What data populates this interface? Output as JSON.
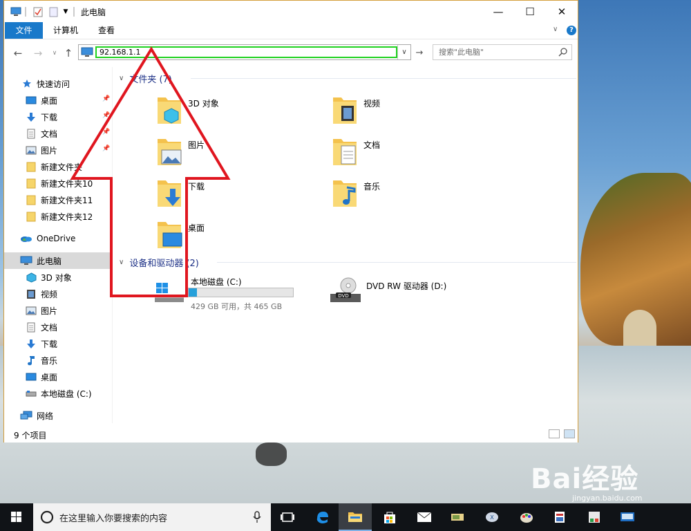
{
  "window": {
    "title": "此电脑",
    "controls": [
      "minimize-icon",
      "maximize-icon",
      "close-icon"
    ]
  },
  "ribbon": {
    "tabs": [
      "文件",
      "计算机",
      "查看"
    ]
  },
  "address": {
    "value": "92.168.1.1",
    "search_placeholder": "搜索\"此电脑\""
  },
  "sidebar": {
    "items": [
      {
        "label": "快速访问",
        "icon": "star-icon",
        "pinned": false
      },
      {
        "label": "桌面",
        "icon": "desktop-icon",
        "pinned": true
      },
      {
        "label": "下载",
        "icon": "download-icon",
        "pinned": true
      },
      {
        "label": "文档",
        "icon": "document-icon",
        "pinned": true
      },
      {
        "label": "图片",
        "icon": "picture-icon",
        "pinned": true
      },
      {
        "label": "新建文件夹",
        "icon": "folder-icon",
        "pinned": false
      },
      {
        "label": "新建文件夹10",
        "icon": "folder-icon",
        "pinned": false
      },
      {
        "label": "新建文件夹11",
        "icon": "folder-icon",
        "pinned": false
      },
      {
        "label": "新建文件夹12",
        "icon": "folder-icon",
        "pinned": false
      },
      {
        "label": "OneDrive",
        "icon": "onedrive-icon",
        "pinned": false
      },
      {
        "label": "此电脑",
        "icon": "computer-icon",
        "pinned": false,
        "selected": true
      },
      {
        "label": "3D 对象",
        "icon": "3d-objects-icon",
        "pinned": false
      },
      {
        "label": "视频",
        "icon": "video-icon",
        "pinned": false
      },
      {
        "label": "图片",
        "icon": "picture-icon",
        "pinned": false
      },
      {
        "label": "文档",
        "icon": "document-icon",
        "pinned": false
      },
      {
        "label": "下载",
        "icon": "download-icon",
        "pinned": false
      },
      {
        "label": "音乐",
        "icon": "music-icon",
        "pinned": false
      },
      {
        "label": "桌面",
        "icon": "desktop-icon",
        "pinned": false
      },
      {
        "label": "本地磁盘 (C:)",
        "icon": "drive-icon",
        "pinned": false
      },
      {
        "label": "网络",
        "icon": "network-icon",
        "pinned": false
      }
    ]
  },
  "folders_group": {
    "header": "文件夹 (7)",
    "items": [
      {
        "label": "3D 对象",
        "icon": "3d-objects-folder-icon"
      },
      {
        "label": "视频",
        "icon": "video-folder-icon"
      },
      {
        "label": "图片",
        "icon": "picture-folder-icon"
      },
      {
        "label": "文档",
        "icon": "document-folder-icon"
      },
      {
        "label": "下载",
        "icon": "download-folder-icon"
      },
      {
        "label": "音乐",
        "icon": "music-folder-icon"
      },
      {
        "label": "桌面",
        "icon": "desktop-folder-icon"
      }
    ]
  },
  "drives_group": {
    "header": "设备和驱动器 (2)",
    "items": [
      {
        "label": "本地磁盘 (C:)",
        "detail": "429 GB 可用，共 465 GB",
        "used_fraction": 0.077,
        "icon": "windows-drive-icon"
      },
      {
        "label": "DVD RW 驱动器 (D:)",
        "detail": "",
        "icon": "dvd-drive-icon"
      }
    ]
  },
  "status": {
    "count": "9 个项目"
  },
  "taskbar": {
    "search_text": "在这里输入你要搜索的内容",
    "apps": [
      "task-view-icon",
      "edge-icon",
      "file-explorer-icon",
      "store-icon",
      "mail-icon",
      "app-icon",
      "app-icon",
      "paint-icon",
      "app-icon",
      "app-icon",
      "app-icon"
    ]
  },
  "watermark": {
    "brand": "Bai经验",
    "url": "jingyan.baidu.com"
  },
  "colors": {
    "accent": "#1979ca",
    "highlight_box": "#1fd21f",
    "annotation_arrow": "#e0161f"
  }
}
